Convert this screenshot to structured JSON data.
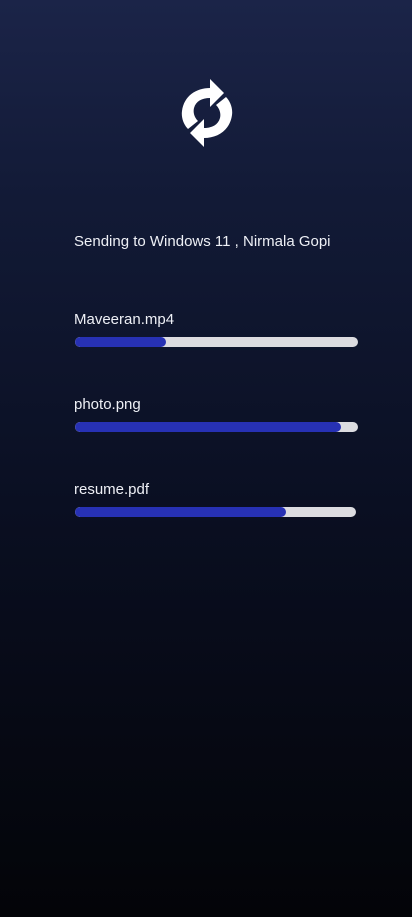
{
  "status": {
    "text": "Sending to Windows 11 , Nirmala Gopi",
    "icon": "sync-icon"
  },
  "transfers": [
    {
      "file_name": "Maveeran.mp4",
      "progress": 0.32
    },
    {
      "file_name": "photo.png",
      "progress": 0.94
    },
    {
      "file_name": "resume.pdf",
      "progress": 0.75
    }
  ],
  "colors": {
    "progress_fill": "#2731b4",
    "progress_track": "#dcdce0",
    "text": "#eef0f6"
  }
}
